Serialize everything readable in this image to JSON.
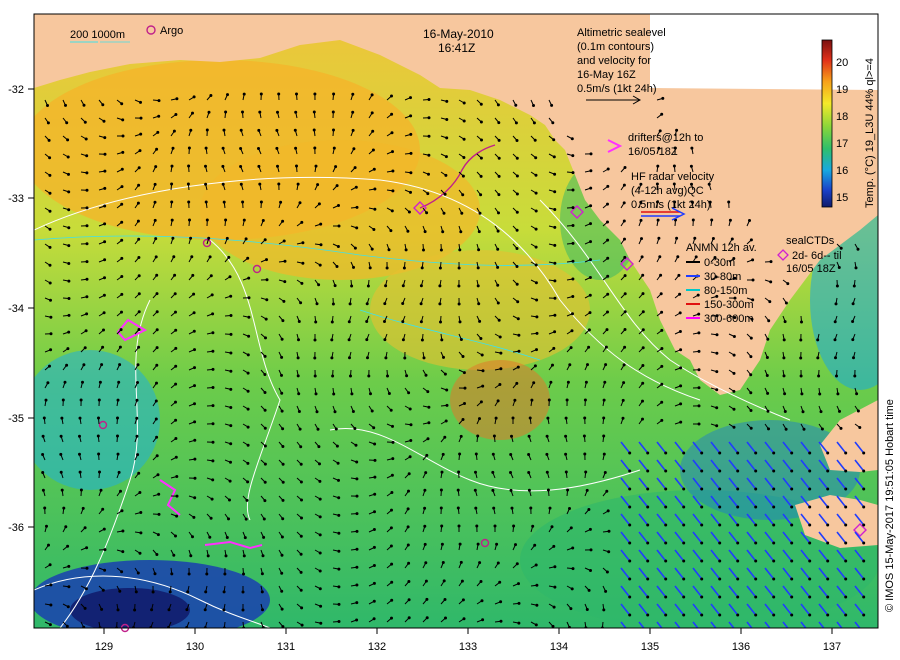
{
  "date_title": "16-May-2010",
  "time_title": "16:41Z",
  "bathy_legend": {
    "label": "200  1000m"
  },
  "argo_legend": {
    "label": "Argo"
  },
  "altimetry_legend": {
    "lines": [
      "Altimetric sealevel",
      "(0.1m contours)",
      "and velocity for",
      "16-May 16Z",
      "0.5m/s (1kt 24h)"
    ]
  },
  "drifters_legend": {
    "lines": [
      "drifters@12h to",
      "16/05 18Z"
    ]
  },
  "hf_radar_legend": {
    "lines": [
      "HF radar velocity",
      "(4-12h avg)QC",
      "0.5m/s (1kt 24h)"
    ]
  },
  "anmn_legend": {
    "title": "ANMN 12h av.",
    "items": [
      {
        "label": "0-30m",
        "color": "#000000"
      },
      {
        "label": "30-80m",
        "color": "#1f3cff"
      },
      {
        "label": "80-150m",
        "color": "#00c8c8"
      },
      {
        "label": "150-300m",
        "color": "#e01010"
      },
      {
        "label": "300-600m",
        "color": "#ff00ff"
      }
    ]
  },
  "sealctd_legend": {
    "lines": [
      "sealCTDs",
      "2d- 6d-- til",
      "16/05 18Z"
    ]
  },
  "colorbar": {
    "label": "Temp. (°C) 19_L3U 44% ql>=4",
    "ticks": [
      "20",
      "19",
      "18",
      "17",
      "16",
      "15"
    ]
  },
  "credit": "© IMOS 15-May-2017 19:51:05 Hobart time",
  "axes": {
    "x_ticks": [
      "129",
      "130",
      "131",
      "132",
      "133",
      "134",
      "135",
      "136",
      "137"
    ],
    "y_ticks": [
      "-32",
      "-33",
      "-34",
      "-35",
      "-36"
    ]
  },
  "colors": {
    "land": "#f7c79e",
    "ocean_warm": "#f5b62a",
    "ocean_mid": "#7fd24a",
    "ocean_cool": "#1aa8e0"
  }
}
